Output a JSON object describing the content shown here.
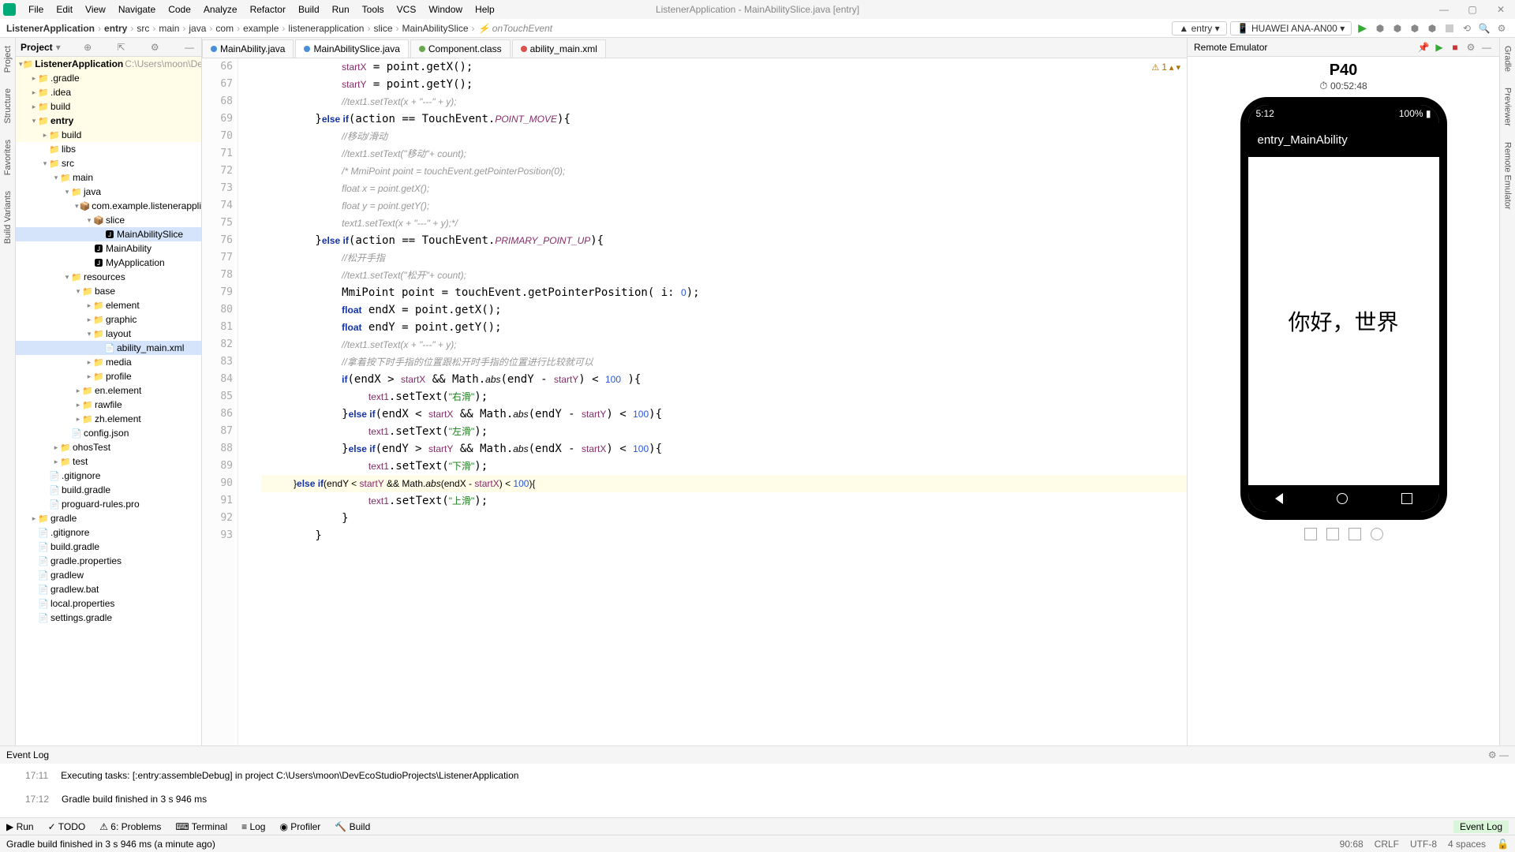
{
  "window": {
    "title": "ListenerApplication - MainAbilitySlice.java [entry]"
  },
  "menu": [
    "File",
    "Edit",
    "View",
    "Navigate",
    "Code",
    "Analyze",
    "Refactor",
    "Build",
    "Run",
    "Tools",
    "VCS",
    "Window",
    "Help"
  ],
  "breadcrumb": {
    "parts": [
      "ListenerApplication",
      "entry",
      "src",
      "main",
      "java",
      "com",
      "example",
      "listenerapplication",
      "slice",
      "MainAbilitySlice",
      "onTouchEvent"
    ],
    "module": "entry",
    "device": "HUAWEI ANA-AN00"
  },
  "project": {
    "label": "Project",
    "tree": [
      {
        "d": 0,
        "a": "▾",
        "i": "📁",
        "t": "ListenerApplication",
        "dim": "C:\\Users\\moon\\DevEco",
        "hl": true,
        "bold": true
      },
      {
        "d": 1,
        "a": "▸",
        "i": "📁",
        "t": ".gradle",
        "hl": true
      },
      {
        "d": 1,
        "a": "▸",
        "i": "📁",
        "t": ".idea",
        "hl": true
      },
      {
        "d": 1,
        "a": "▸",
        "i": "📁",
        "t": "build",
        "hl": true
      },
      {
        "d": 1,
        "a": "▾",
        "i": "📁",
        "t": "entry",
        "hl": true,
        "bold": true
      },
      {
        "d": 2,
        "a": "▸",
        "i": "📁",
        "t": "build",
        "hl": true
      },
      {
        "d": 2,
        "a": "",
        "i": "📁",
        "t": "libs"
      },
      {
        "d": 2,
        "a": "▾",
        "i": "📁",
        "t": "src"
      },
      {
        "d": 3,
        "a": "▾",
        "i": "📁",
        "t": "main"
      },
      {
        "d": 4,
        "a": "▾",
        "i": "📁",
        "t": "java"
      },
      {
        "d": 5,
        "a": "▾",
        "i": "📦",
        "t": "com.example.listenerappli"
      },
      {
        "d": 6,
        "a": "▾",
        "i": "📦",
        "t": "slice"
      },
      {
        "d": 7,
        "a": "",
        "i": "🅹",
        "t": "MainAbilitySlice",
        "sel": true
      },
      {
        "d": 6,
        "a": "",
        "i": "🅹",
        "t": "MainAbility"
      },
      {
        "d": 6,
        "a": "",
        "i": "🅹",
        "t": "MyApplication"
      },
      {
        "d": 4,
        "a": "▾",
        "i": "📁",
        "t": "resources"
      },
      {
        "d": 5,
        "a": "▾",
        "i": "📁",
        "t": "base"
      },
      {
        "d": 6,
        "a": "▸",
        "i": "📁",
        "t": "element"
      },
      {
        "d": 6,
        "a": "▸",
        "i": "📁",
        "t": "graphic"
      },
      {
        "d": 6,
        "a": "▾",
        "i": "📁",
        "t": "layout"
      },
      {
        "d": 7,
        "a": "",
        "i": "📄",
        "t": "ability_main.xml",
        "sel": true
      },
      {
        "d": 6,
        "a": "▸",
        "i": "📁",
        "t": "media"
      },
      {
        "d": 6,
        "a": "▸",
        "i": "📁",
        "t": "profile"
      },
      {
        "d": 5,
        "a": "▸",
        "i": "📁",
        "t": "en.element"
      },
      {
        "d": 5,
        "a": "▸",
        "i": "📁",
        "t": "rawfile"
      },
      {
        "d": 5,
        "a": "▸",
        "i": "📁",
        "t": "zh.element"
      },
      {
        "d": 4,
        "a": "",
        "i": "📄",
        "t": "config.json"
      },
      {
        "d": 3,
        "a": "▸",
        "i": "📁",
        "t": "ohosTest"
      },
      {
        "d": 3,
        "a": "▸",
        "i": "📁",
        "t": "test"
      },
      {
        "d": 2,
        "a": "",
        "i": "📄",
        "t": ".gitignore"
      },
      {
        "d": 2,
        "a": "",
        "i": "📄",
        "t": "build.gradle"
      },
      {
        "d": 2,
        "a": "",
        "i": "📄",
        "t": "proguard-rules.pro"
      },
      {
        "d": 1,
        "a": "▸",
        "i": "📁",
        "t": "gradle"
      },
      {
        "d": 1,
        "a": "",
        "i": "📄",
        "t": ".gitignore"
      },
      {
        "d": 1,
        "a": "",
        "i": "📄",
        "t": "build.gradle"
      },
      {
        "d": 1,
        "a": "",
        "i": "📄",
        "t": "gradle.properties"
      },
      {
        "d": 1,
        "a": "",
        "i": "📄",
        "t": "gradlew"
      },
      {
        "d": 1,
        "a": "",
        "i": "📄",
        "t": "gradlew.bat"
      },
      {
        "d": 1,
        "a": "",
        "i": "📄",
        "t": "local.properties"
      },
      {
        "d": 1,
        "a": "",
        "i": "📄",
        "t": "settings.gradle"
      }
    ]
  },
  "tabs": [
    {
      "label": "MainAbility.java",
      "active": false,
      "color": "#4a90d9"
    },
    {
      "label": "MainAbilitySlice.java",
      "active": true,
      "color": "#4a90d9"
    },
    {
      "label": "Component.class",
      "active": false,
      "color": "#6aa84f"
    },
    {
      "label": "ability_main.xml",
      "active": false,
      "color": "#d9534f"
    }
  ],
  "editor": {
    "first_line": 66,
    "warn_count": "1",
    "lines": [
      "            <span class='fld'>startX</span> = point.getX();",
      "            <span class='fld'>startY</span> = point.getY();",
      "            <span class='cm'>//text1.setText(x + \"---\" + y);</span>",
      "        }<span class='kw'>else if</span>(action == TouchEvent.<span class='fld2'>POINT_MOVE</span>){",
      "            <span class='cm'>//移动/滑动</span>",
      "            <span class='cm'>//text1.setText(\"移动\"+ count);</span>",
      "            <span class='cm'>/* MmiPoint point = touchEvent.getPointerPosition(0);</span>",
      "            <span class='cm'>float x = point.getX();</span>",
      "            <span class='cm'>float y = point.getY();</span>",
      "            <span class='cm'>text1.setText(x + \"---\" + y);*/</span>",
      "        }<span class='kw'>else if</span>(action == TouchEvent.<span class='fld2'>PRIMARY_POINT_UP</span>){",
      "            <span class='cm'>//松开手指</span>",
      "            <span class='cm'>//text1.setText(\"松开\"+ count);</span>",
      "            MmiPoint point = touchEvent.getPointerPosition( i: <span class='num'>0</span>);",
      "            <span class='kw'>float</span> endX = point.getX();",
      "            <span class='kw'>float</span> endY = point.getY();",
      "            <span class='cm'>//text1.setText(x + \"---\" + y);</span>",
      "            <span class='cm'>//拿着按下时手指的位置跟松开时手指的位置进行比较就可以</span>",
      "            <span class='kw'>if</span>(endX &gt; <span class='fld'>startX</span> &amp;&amp; Math.<span class='it'>abs</span>(endY - <span class='fld'>startY</span>) &lt; <span class='num'>100</span> ){",
      "                <span class='fld'>text1</span>.setText(<span class='str'>\"右滑\"</span>);",
      "            }<span class='kw'>else if</span>(endX &lt; <span class='fld'>startX</span> &amp;&amp; Math.<span class='it'>abs</span>(endY - <span class='fld'>startY</span>) &lt; <span class='num'>100</span>){",
      "                <span class='fld'>text1</span>.setText(<span class='str'>\"左滑\"</span>);",
      "            }<span class='kw'>else if</span>(endY &gt; <span class='fld'>startY</span> &amp;&amp; Math.<span class='it'>abs</span>(endX - <span class='fld'>startX</span>) &lt; <span class='num'>100</span>){",
      "                <span class='fld'>text1</span>.setText(<span class='str'>\"下滑\"</span>);",
      "<span class='hl-line'>            }<span class='kw'>else if</span>(endY &lt; <span class='fld'>startY</span> &amp;&amp; Math.<span class='it'>abs</span>(endX - <span class='fld'>startX</span>) &lt; <span class='num'>100</span>){</span>",
      "                <span class='fld'>text1</span>.setText(<span class='str'>\"上滑\"</span>);",
      "            }",
      "        }"
    ]
  },
  "emulator": {
    "title": "Remote Emulator",
    "device": "P40",
    "elapsed": "00:52:48",
    "status_time": "5:12",
    "battery": "100%",
    "appbar": "entry_MainAbility",
    "content": "你好，世界"
  },
  "eventlog": {
    "title": "Event Log",
    "rows": [
      {
        "time": "17:11",
        "msg": "Executing tasks: [:entry:assembleDebug] in project C:\\Users\\moon\\DevEcoStudioProjects\\ListenerApplication"
      },
      {
        "time": "17:12",
        "msg": "Gradle build finished in 3 s 946 ms"
      }
    ]
  },
  "bottom": {
    "items": [
      "Run",
      "TODO",
      "Problems",
      "Terminal",
      "Log",
      "Profiler",
      "Build"
    ],
    "right": "Event Log"
  },
  "status": {
    "left": "Gradle build finished in 3 s 946 ms (a minute ago)",
    "pos": "90:68",
    "eol": "CRLF",
    "enc": "UTF-8",
    "ind": "4 spaces"
  },
  "leftstrip": [
    "Project",
    "Structure",
    "Favorites",
    "Build Variants"
  ],
  "rightstrip": [
    "Gradle",
    "Previewer",
    "Remote Emulator"
  ]
}
